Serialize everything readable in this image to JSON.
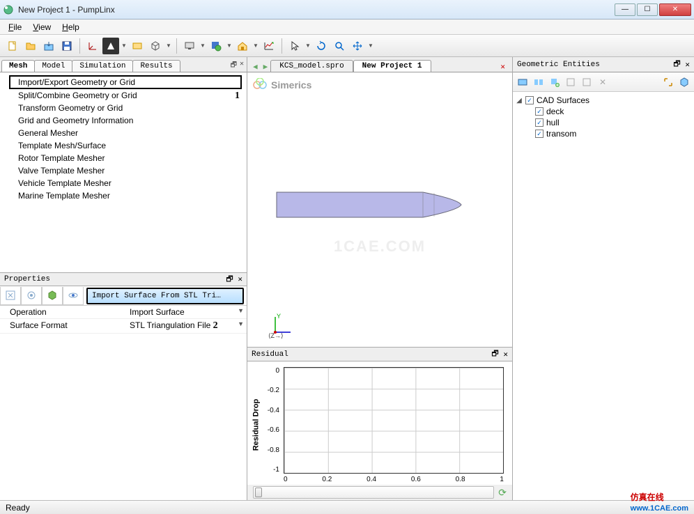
{
  "window": {
    "title": "New Project 1 - PumpLinx"
  },
  "menu": {
    "file": "File",
    "view": "View",
    "help": "Help"
  },
  "left_tabs": {
    "mesh": "Mesh",
    "model": "Model",
    "simulation": "Simulation",
    "results": "Results"
  },
  "mesh_items": [
    "Import/Export Geometry or Grid",
    "Split/Combine Geometry or Grid",
    "Transform Geometry or Grid",
    "Grid and Geometry Information",
    "General Mesher",
    "Template Mesh/Surface",
    "Rotor Template Mesher",
    "Valve Template Mesher",
    "Vehicle Template Mesher",
    "Marine Template Mesher"
  ],
  "annotations": {
    "one": "1",
    "two": "2"
  },
  "properties": {
    "title": "Properties",
    "import_btn": "Import Surface From STL Tri…",
    "rows": [
      {
        "k": "Operation",
        "v": "Import Surface"
      },
      {
        "k": "Surface Format",
        "v": "STL Triangulation File"
      }
    ]
  },
  "doc_tabs": {
    "file1": "KCS_model.spro",
    "file2": "New Project 1"
  },
  "viewport": {
    "brand": "Simerics",
    "watermark": "1CAE.COM"
  },
  "axes": {
    "y": "Y",
    "z": "Z"
  },
  "residual": {
    "title": "Residual",
    "ylabel": "Residual Drop"
  },
  "geo": {
    "title": "Geometric Entities",
    "root": "CAD Surfaces",
    "children": [
      "deck",
      "hull",
      "transom"
    ]
  },
  "status": {
    "text": "Ready"
  },
  "footer": {
    "cn": "仿真在线",
    "url": "www.1CAE.com"
  },
  "chart_data": {
    "type": "line",
    "title": "",
    "xlabel": "",
    "ylabel": "Residual Drop",
    "xlim": [
      0,
      1
    ],
    "ylim": [
      -1,
      0
    ],
    "xticks": [
      0,
      0.2,
      0.4,
      0.6,
      0.8,
      1
    ],
    "yticks": [
      0,
      -0.2,
      -0.4,
      -0.6,
      -0.8,
      -1
    ],
    "series": []
  }
}
